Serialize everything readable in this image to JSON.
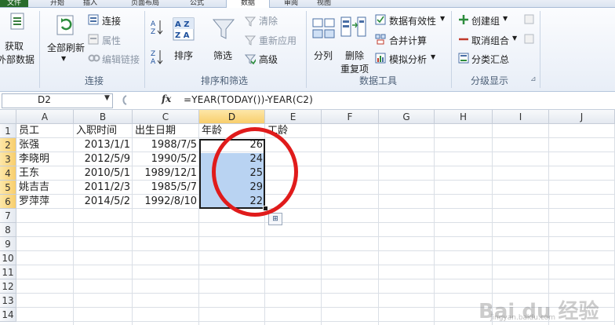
{
  "tabs": [
    "文件",
    "开始",
    "插入",
    "页面布局",
    "公式",
    "数据",
    "审阅",
    "视图"
  ],
  "active_tab": "数据",
  "ribbon": {
    "get_data_label1": "获取",
    "get_data_label2": "外部数据",
    "refresh_all": "全部刷新",
    "connections": "连接",
    "properties": "属性",
    "edit_links": "编辑链接",
    "group_connections": "连接",
    "sort_az": "A→Z",
    "sort": "排序",
    "filter": "筛选",
    "clear": "清除",
    "reapply": "重新应用",
    "advanced": "高级",
    "group_sort_filter": "排序和筛选",
    "text_to_columns": "分列",
    "remove_duplicates1": "删除",
    "remove_duplicates2": "重复项",
    "data_validation": "数据有效性",
    "consolidate": "合并计算",
    "what_if": "模拟分析",
    "group_data_tools": "数据工具",
    "group": "创建组",
    "ungroup": "取消组合",
    "subtotal": "分类汇总",
    "group_outline": "分级显示"
  },
  "formula_bar": {
    "name_box": "D2",
    "fx": "fx",
    "formula": "=YEAR(TODAY())-YEAR(C2)"
  },
  "columns": [
    "A",
    "B",
    "C",
    "D",
    "E",
    "F",
    "G",
    "H",
    "I",
    "J"
  ],
  "rows": [
    "1",
    "2",
    "3",
    "4",
    "5",
    "6",
    "7",
    "8",
    "9",
    "10",
    "11",
    "12",
    "13",
    "14"
  ],
  "cells": {
    "A1": "员工",
    "B1": "入职时间",
    "C1": "出生日期",
    "D1": "年龄",
    "E1": "工龄",
    "A2": "张强",
    "B2": "2013/1/1",
    "C2": "1988/7/5",
    "D2": "26",
    "A3": "李晓明",
    "B3": "2012/5/9",
    "C3": "1990/5/2",
    "D3": "24",
    "A4": "王东",
    "B4": "2010/5/1",
    "C4": "1989/12/1",
    "D4": "25",
    "A5": "姚吉吉",
    "B5": "2011/2/3",
    "C5": "1985/5/7",
    "D5": "29",
    "A6": "罗萍萍",
    "B6": "2014/5/2",
    "C6": "1992/8/10",
    "D6": "22"
  },
  "watermark": {
    "brand": "Bai du 经验",
    "url": "jingyan.baidu.com"
  },
  "colors": {
    "selection_border": "#1b1b1b",
    "selection_fill": "#b9d3f2",
    "annotation_circle": "#e01b1b",
    "header_selected": "#f8ce6c"
  }
}
